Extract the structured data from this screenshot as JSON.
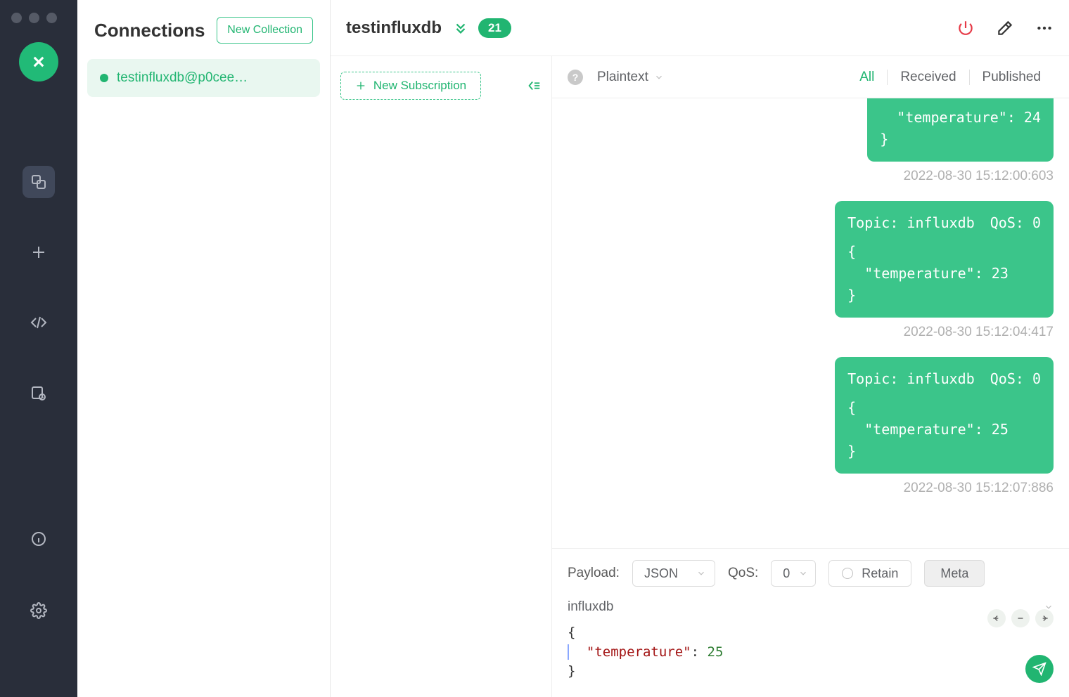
{
  "sidebar_title": "Connections",
  "new_collection_label": "New Collection",
  "connections": [
    {
      "name": "testinfluxdb@p0cee…",
      "status": "online"
    }
  ],
  "header": {
    "title": "testinfluxdb",
    "badge": "21"
  },
  "subscriptions": {
    "new_label": "New Subscription"
  },
  "toolbar": {
    "help": "?",
    "format": "Plaintext",
    "tabs": {
      "all": "All",
      "received": "Received",
      "published": "Published"
    }
  },
  "messages": [
    {
      "partial": true,
      "body": "  \"temperature\": 24\n}",
      "time": "2022-08-30 15:12:00:603"
    },
    {
      "topic_label": "Topic:",
      "topic": "influxdb",
      "qos_label": "QoS:",
      "qos": "0",
      "body": "{\n  \"temperature\": 23\n}",
      "time": "2022-08-30 15:12:04:417"
    },
    {
      "topic_label": "Topic:",
      "topic": "influxdb",
      "qos_label": "QoS:",
      "qos": "0",
      "body": "{\n  \"temperature\": 25\n}",
      "time": "2022-08-30 15:12:07:886"
    }
  ],
  "compose": {
    "payload_label": "Payload:",
    "payload_format": "JSON",
    "qos_label": "QoS:",
    "qos_value": "0",
    "retain_label": "Retain",
    "meta_label": "Meta",
    "topic": "influxdb",
    "editor_open": "{",
    "editor_key": "\"temperature\"",
    "editor_colon": ": ",
    "editor_value": "25",
    "editor_close": "}"
  }
}
